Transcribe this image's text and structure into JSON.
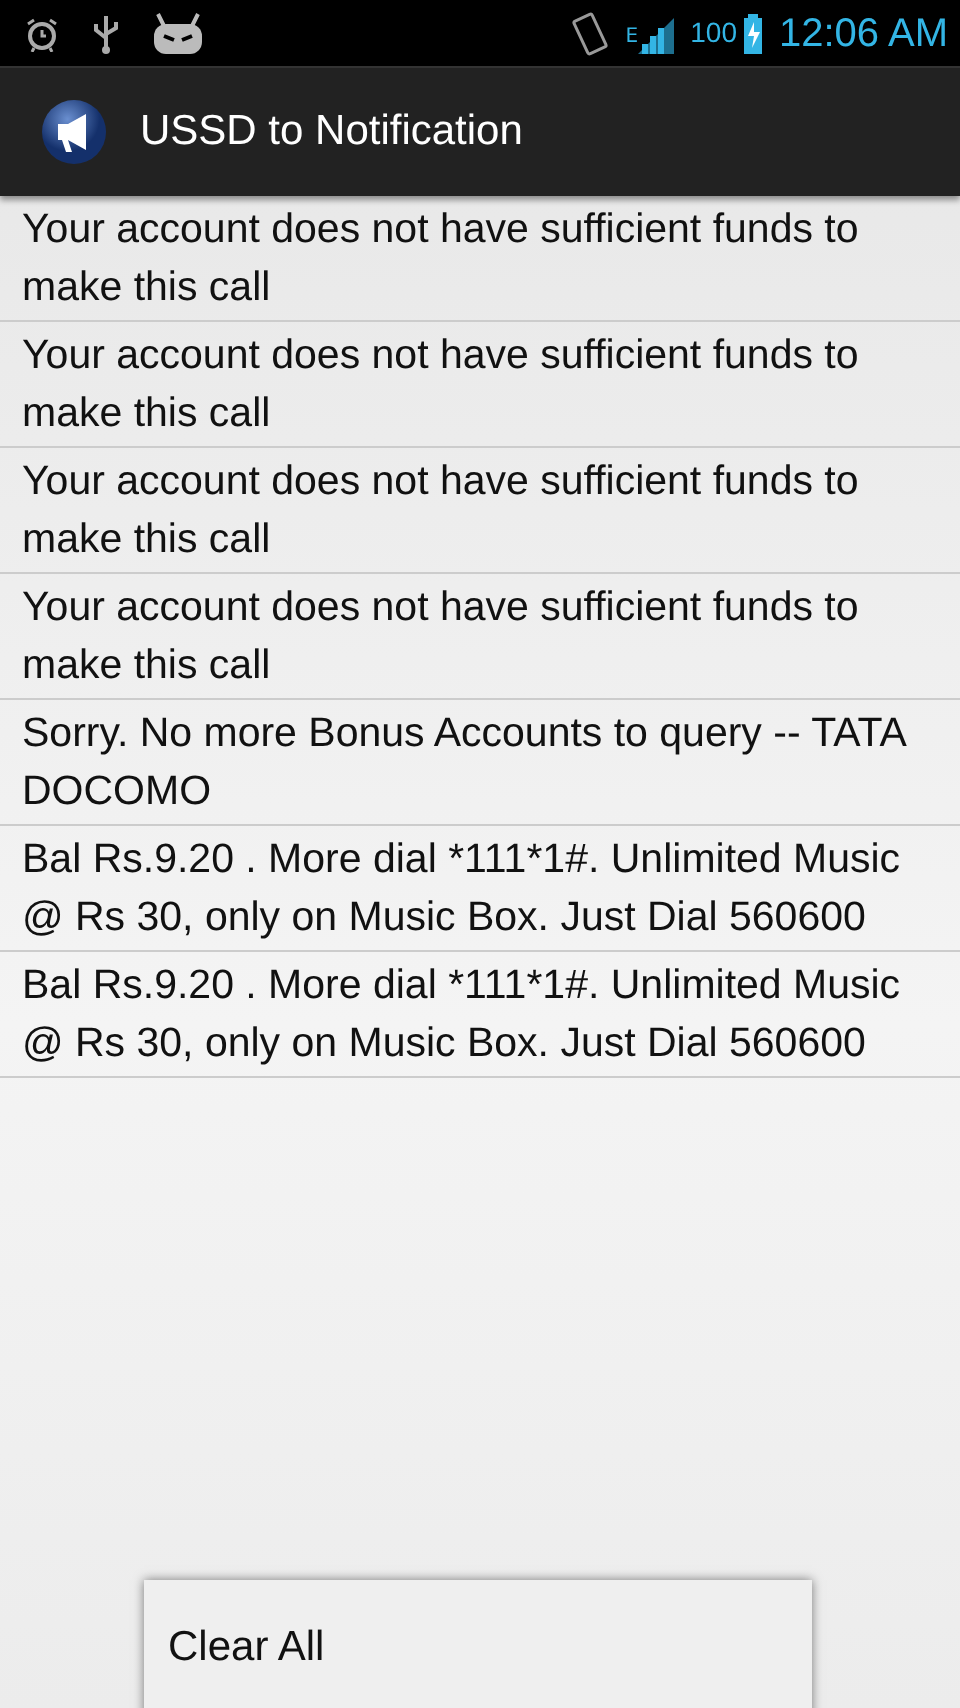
{
  "status_bar": {
    "network_type": "E",
    "battery": "100",
    "time": "12:06 AM"
  },
  "app_bar": {
    "title": "USSD to Notification"
  },
  "messages": [
    {
      "text": "Your account does not have sufficient funds to make this call"
    },
    {
      "text": "Your account does not have sufficient funds to make this call"
    },
    {
      "text": "Your account does not have sufficient funds to make this call"
    },
    {
      "text": "Your account does not have sufficient funds to make this call"
    },
    {
      "text": "Sorry. No more Bonus Accounts to query -- TATA DOCOMO"
    },
    {
      "text": "Bal Rs.9.20  . More dial *111*1#. Unlimited Music @ Rs 30, only on Music Box. Just Dial 560600"
    },
    {
      "text": "Bal Rs.9.20  . More dial *111*1#. Unlimited Music @ Rs 30, only on Music Box. Just Dial 560600"
    }
  ],
  "menu": {
    "items": [
      "Clear All"
    ]
  }
}
